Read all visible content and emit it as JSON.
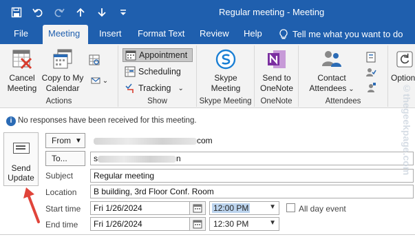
{
  "window": {
    "title": "Regular meeting  -  Meeting"
  },
  "quick_access": [
    {
      "name": "save-icon"
    },
    {
      "name": "undo-icon"
    },
    {
      "name": "redo-icon"
    },
    {
      "name": "up-arrow-icon"
    },
    {
      "name": "down-arrow-icon"
    },
    {
      "name": "customize-qat-icon"
    }
  ],
  "tabs": [
    "File",
    "Meeting",
    "Insert",
    "Format Text",
    "Review",
    "Help"
  ],
  "active_tab": "Meeting",
  "tell_me": "Tell me what you want to do",
  "ribbon": {
    "actions": {
      "label": "Actions",
      "cancel_line1": "Cancel",
      "cancel_line2": "Meeting",
      "copy_line1": "Copy to My",
      "copy_line2": "Calendar"
    },
    "show": {
      "label": "Show",
      "appointment": "Appointment",
      "scheduling": "Scheduling",
      "tracking": "Tracking"
    },
    "skype": {
      "label": "Skype Meeting",
      "btn_line1": "Skype",
      "btn_line2": "Meeting"
    },
    "onenote": {
      "label": "OneNote",
      "btn_line1": "Send to",
      "btn_line2": "OneNote"
    },
    "attendees": {
      "label": "Attendees",
      "btn_line1": "Contact",
      "btn_line2": "Attendees"
    },
    "options": {
      "label": "Option"
    }
  },
  "info_message": "No responses have been received for this meeting.",
  "send": {
    "line1": "Send",
    "line2": "Update"
  },
  "form": {
    "from_label": "From",
    "from_value_suffix": "com",
    "to_label": "To...",
    "to_value_prefix": "s",
    "to_value_suffix": "n",
    "subject_label": "Subject",
    "subject_value": "Regular meeting",
    "location_label": "Location",
    "location_value": "B building, 3rd Floor Conf. Room",
    "start_label": "Start time",
    "start_date": "Fri 1/26/2024",
    "start_time": "12:00 PM",
    "end_label": "End time",
    "end_date": "Fri 1/26/2024",
    "end_time": "12:30 PM",
    "all_day_label": "All day event"
  },
  "watermark": "©thegeekpage.com",
  "colors": {
    "titlebar": "#1f5fae",
    "ribbon": "#f3f3f3",
    "accent": "#2b6bb5",
    "annotation_arrow": "#e0443a"
  }
}
